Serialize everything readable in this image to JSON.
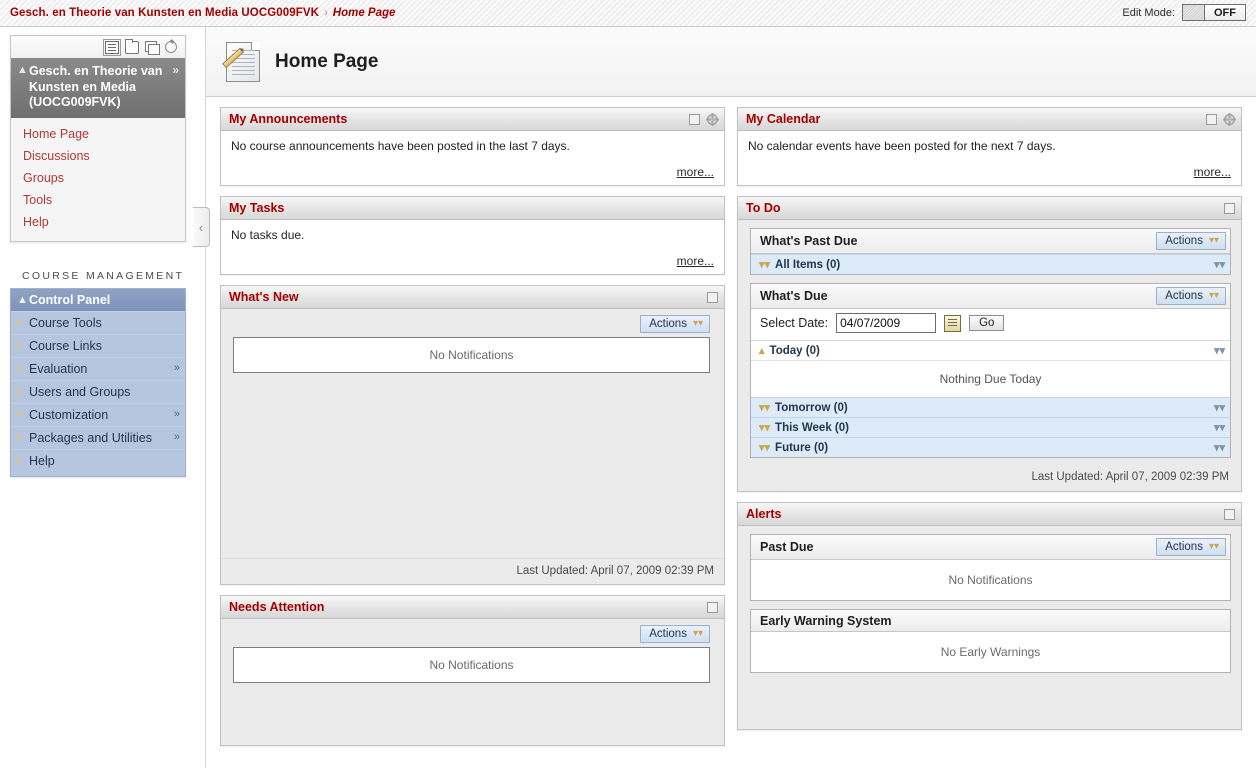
{
  "breadcrumb": {
    "course": "Gesch. en Theorie van Kunsten en Media UOCG009FVK",
    "separator": "›",
    "current": "Home Page"
  },
  "edit_mode": {
    "label": "Edit Mode:",
    "state": "OFF"
  },
  "sidebar": {
    "tool_icons": [
      "list-view-icon",
      "folder-view-icon",
      "window-view-icon",
      "refresh-icon"
    ],
    "course_title": "Gesch. en Theorie van Kunsten en Media (UOCG009FVK)",
    "nav_items": [
      {
        "label": "Home Page"
      },
      {
        "label": "Discussions"
      },
      {
        "label": "Groups"
      },
      {
        "label": "Tools"
      },
      {
        "label": "Help"
      }
    ],
    "course_management_label": "COURSE MANAGEMENT",
    "control_panel_title": "Control Panel",
    "control_panel_items": [
      {
        "label": "Course Tools",
        "expand": false
      },
      {
        "label": "Course Links",
        "expand": false
      },
      {
        "label": "Evaluation",
        "expand": true
      },
      {
        "label": "Users and Groups",
        "expand": false
      },
      {
        "label": "Customization",
        "expand": true
      },
      {
        "label": "Packages and Utilities",
        "expand": true
      },
      {
        "label": "Help",
        "expand": false
      }
    ],
    "collapse_handle": "‹"
  },
  "page": {
    "title": "Home Page",
    "icon": "document-pencil-icon"
  },
  "modules": {
    "my_announcements": {
      "title": "My Announcements",
      "text": "No course announcements have been posted in the last 7 days.",
      "more": "more..."
    },
    "my_calendar": {
      "title": "My Calendar",
      "text": "No calendar events have been posted for the next 7 days.",
      "more": "more..."
    },
    "my_tasks": {
      "title": "My Tasks",
      "text": "No tasks due.",
      "more": "more..."
    },
    "whats_new": {
      "title": "What's New",
      "actions": "Actions",
      "empty": "No Notifications",
      "last_updated": "Last Updated: April 07, 2009 02:39 PM"
    },
    "needs_attention": {
      "title": "Needs Attention",
      "actions": "Actions",
      "empty": "No Notifications"
    },
    "to_do": {
      "title": "To Do",
      "past_due": {
        "title": "What's Past Due",
        "actions": "Actions",
        "rows": [
          {
            "label": "All Items (0)",
            "expanded": false
          }
        ]
      },
      "whats_due": {
        "title": "What's Due",
        "actions": "Actions",
        "select_date_label": "Select Date:",
        "date_value": "04/07/2009",
        "go_label": "Go",
        "today_label": "Today (0)",
        "today_empty": "Nothing Due Today",
        "rows": [
          {
            "label": "Tomorrow (0)"
          },
          {
            "label": "This Week (0)"
          },
          {
            "label": "Future (0)"
          }
        ]
      },
      "last_updated": "Last Updated: April 07, 2009 02:39 PM"
    },
    "alerts": {
      "title": "Alerts",
      "past_due": {
        "title": "Past Due",
        "actions": "Actions",
        "empty": "No Notifications"
      },
      "early_warning": {
        "title": "Early Warning System",
        "empty": "No Early Warnings"
      }
    }
  },
  "colors": {
    "accent_red": "#a40000",
    "link_red": "#b03a34",
    "panel_blue": "#b6c6df",
    "actions_blue": "#cfdff1"
  }
}
